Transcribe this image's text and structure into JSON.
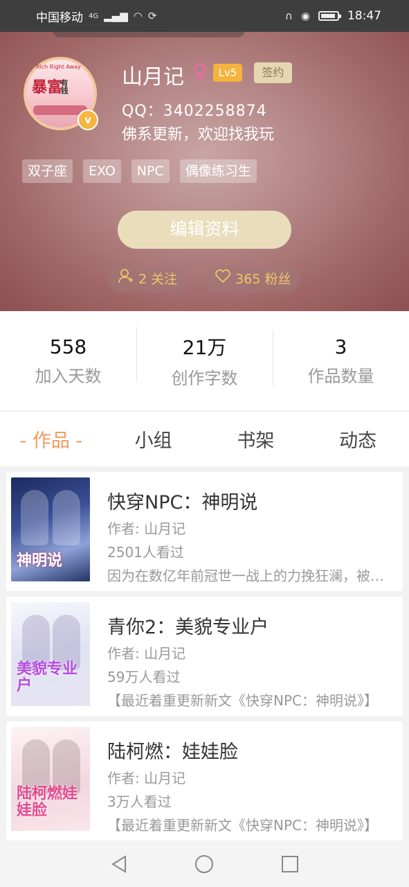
{
  "status_bar": {
    "carrier": "中国移动",
    "network": "4G",
    "time": "18:47"
  },
  "profile": {
    "avatar_text": "暴富",
    "avatar_small_text": "有钱",
    "avatar_top_text": "Rich Right Away",
    "username": "山月记",
    "gender_symbol": "♀",
    "level": "Lv5",
    "sign_badge": "签约",
    "qq": "QQ：3402258874",
    "bio": "佛系更新，欢迎找我玩",
    "tags": [
      "双子座",
      "EXO",
      "NPC",
      "偶像练习生"
    ],
    "edit_button": "编辑资料",
    "following": "2 关注",
    "fans": "365 粉丝"
  },
  "stats": [
    {
      "value": "558",
      "label": "加入天数"
    },
    {
      "value": "21万",
      "label": "创作字数"
    },
    {
      "value": "3",
      "label": "作品数量"
    }
  ],
  "tabs": [
    "- 作品 -",
    "小组",
    "书架",
    "动态"
  ],
  "works": [
    {
      "title": "快穿NPC：神明说",
      "author": "作者: 山月记",
      "views": "2501人看过",
      "desc": "因为在数亿年前冠世一战上的力挽狂澜，被天道赐予永生不死的神明，在数亿年后成为了一名快穿NPC",
      "cover_text": "神明说"
    },
    {
      "title": "青你2：美貌专业户",
      "author": "作者: 山月记",
      "views": "59万人看过",
      "desc": "【最近着重更新新文《快穿NPC：神明说》】",
      "cover_text": "美貌专业户"
    },
    {
      "title": "陆柯燃：娃娃脸",
      "author": "作者: 山月记",
      "views": "3万人看过",
      "desc": "【最近着重更新新文《快穿NPC：神明说》】",
      "cover_text": "陆柯燃娃娃脸"
    }
  ],
  "colors": {
    "accent": "#f29a5c",
    "level_badge": "#f4b43f",
    "fans_text": "#f2c66a"
  }
}
